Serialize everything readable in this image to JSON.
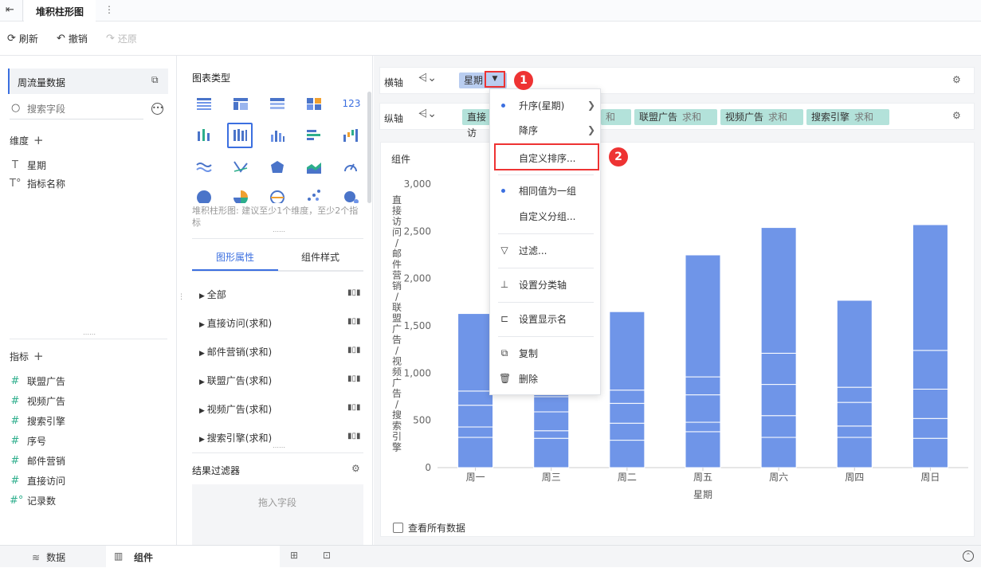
{
  "topbar": {
    "title": "堆积柱形图",
    "more_icon": "⋮"
  },
  "toolbar": {
    "refresh": "刷新",
    "undo": "撤销",
    "redo": "还原"
  },
  "left": {
    "dataset": "周流量数据",
    "search_placeholder": "搜索字段",
    "dimension_header": "维度",
    "dimensions": [
      "星期",
      "指标名称"
    ],
    "measure_header": "指标",
    "measures": [
      "联盟广告",
      "视频广告",
      "搜索引擎",
      "序号",
      "邮件营销",
      "直接访问",
      "记录数"
    ]
  },
  "mid": {
    "chart_type_title": "图表类型",
    "hint": "堆积柱形图: 建议至少1个维度，至少2个指标",
    "tab_graph": "图形属性",
    "tab_style": "组件样式",
    "tree": [
      "全部",
      "直接访问(求和)",
      "邮件营销(求和)",
      "联盟广告(求和)",
      "视频广告(求和)",
      "搜索引擎(求和)"
    ],
    "filter_title": "结果过滤器",
    "drop_placeholder": "拖入字段"
  },
  "axes": {
    "x_label": "横轴",
    "y_label": "纵轴",
    "x_pill": "星期",
    "y_pills": [
      {
        "name": "直接访",
        "agg": ""
      },
      {
        "name": "",
        "agg": "和"
      },
      {
        "name": "联盟广告",
        "agg": "求和"
      },
      {
        "name": "视频广告",
        "agg": "求和"
      },
      {
        "name": "搜索引擎",
        "agg": "求和"
      }
    ]
  },
  "menu": {
    "asc": "升序(星期)",
    "desc": "降序",
    "custom_sort": "自定义排序...",
    "group_same": "相同值为一组",
    "custom_group": "自定义分组...",
    "filter": "过滤...",
    "set_axis": "设置分类轴",
    "set_display": "设置显示名",
    "copy": "复制",
    "delete": "删除"
  },
  "badges": [
    "1",
    "2"
  ],
  "chart": {
    "component_label": "组件",
    "see_all": "查看所有数据"
  },
  "chart_data": {
    "type": "bar",
    "stacked": true,
    "xlabel": "星期",
    "ylabel": "直接访问/邮件营销/联盟广告/视频广告/搜索引擎",
    "categories": [
      "周一",
      "周三",
      "周二",
      "周五",
      "周六",
      "周四",
      "周日"
    ],
    "ylim": [
      0,
      3000
    ],
    "yticks": [
      "0",
      "500",
      "1,000",
      "1,500",
      "2,000",
      "2,500",
      "3,000"
    ],
    "color": "#6f95e8",
    "series": [
      {
        "values": [
          320,
          310,
          290,
          380,
          320,
          320,
          310
        ]
      },
      {
        "values": [
          110,
          80,
          180,
          100,
          230,
          120,
          210
        ]
      },
      {
        "values": [
          230,
          200,
          210,
          290,
          330,
          250,
          310
        ]
      },
      {
        "values": [
          150,
          160,
          140,
          190,
          330,
          160,
          410
        ]
      },
      {
        "values": [
          820,
          30,
          830,
          1290,
          1330,
          920,
          1330
        ]
      }
    ]
  },
  "bottom": {
    "data_tab": "数据",
    "component_tab": "组件"
  }
}
